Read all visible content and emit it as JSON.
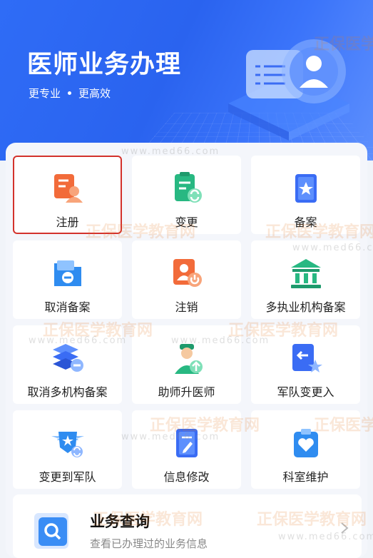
{
  "hero": {
    "title": "医师业务办理",
    "subtitle_left": "更专业",
    "subtitle_right": "更高效"
  },
  "services": [
    {
      "label": "注册",
      "icon": "register-icon",
      "color": "#f26b3a"
    },
    {
      "label": "变更",
      "icon": "change-icon",
      "color": "#28b882"
    },
    {
      "label": "备案",
      "icon": "record-icon",
      "color": "#3a6cf4"
    },
    {
      "label": "取消备案",
      "icon": "cancel-record-icon",
      "color": "#2f8cf0"
    },
    {
      "label": "注销",
      "icon": "deregister-icon",
      "color": "#f26b3a"
    },
    {
      "label": "多执业机构备案",
      "icon": "multi-institution-icon",
      "color": "#28b882"
    },
    {
      "label": "取消多机构备案",
      "icon": "cancel-multi-icon",
      "color": "#3a6cf4"
    },
    {
      "label": "助师升医师",
      "icon": "promote-icon",
      "color": "#28b882"
    },
    {
      "label": "军队变更入",
      "icon": "military-in-icon",
      "color": "#3a6cf4"
    },
    {
      "label": "变更到军队",
      "icon": "to-military-icon",
      "color": "#2f8cf0"
    },
    {
      "label": "信息修改",
      "icon": "edit-info-icon",
      "color": "#3a6cf4"
    },
    {
      "label": "科室维护",
      "icon": "department-icon",
      "color": "#2f8cf0"
    }
  ],
  "query": {
    "title": "业务查询",
    "subtitle": "查看已办理过的业务信息"
  },
  "watermark": {
    "text": "正保医学教育网",
    "url": "www.med66.com"
  }
}
